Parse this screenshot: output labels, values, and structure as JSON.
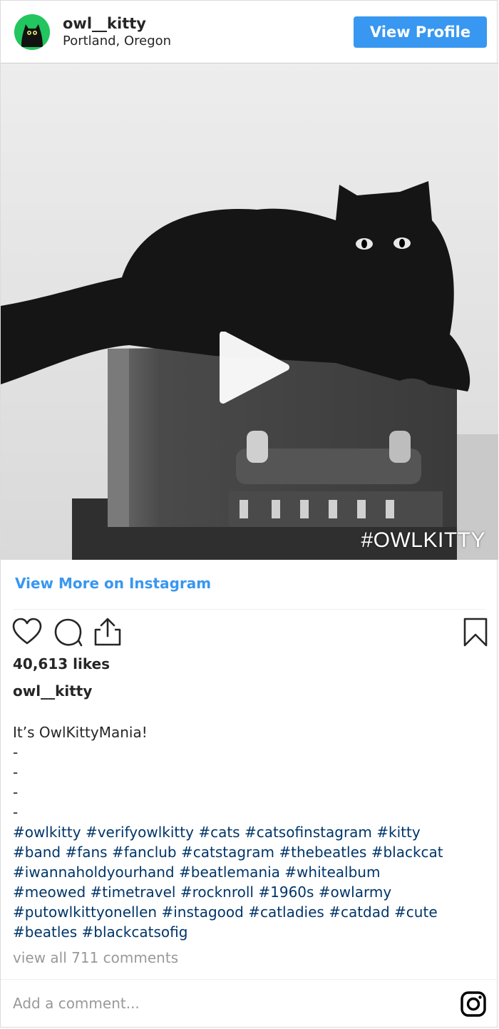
{
  "header": {
    "username": "owl__kitty",
    "location": "Portland, Oregon",
    "view_profile_label": "View Profile"
  },
  "media": {
    "watermark": "#OWLKITTY",
    "play_icon": "play-icon"
  },
  "view_more_label": "View More on Instagram",
  "actions": {
    "icons": [
      "heart-icon",
      "comment-icon",
      "share-icon",
      "bookmark-icon"
    ]
  },
  "likes_text": "40,613 likes",
  "caption": {
    "username": "owl__kitty",
    "lines": [
      "It’s OwlKittyMania!",
      "-",
      "-",
      "-",
      "-"
    ],
    "hashtags": [
      "#owlkitty",
      "#verifyowlkitty",
      "#cats",
      "#catsofinstagram",
      "#kitty",
      "#band",
      "#fans",
      "#fanclub",
      "#catstagram",
      "#thebeatles",
      "#blackcat",
      "#iwannaholdyourhand",
      "#beatlemania",
      "#whitealbum",
      "#meowed",
      "#timetravel",
      "#rocknroll",
      "#1960s",
      "#owlarmy",
      "#putowlkittyonellen",
      "#instagood",
      "#catladies",
      "#catdad",
      "#cute",
      "#beatles",
      "#blackcatsofig"
    ]
  },
  "comments_link": "view all 711 comments",
  "comment_input": {
    "placeholder": "Add a comment..."
  },
  "colors": {
    "accent": "#3897f0",
    "hashtag": "#003569",
    "muted": "#999999",
    "avatar_bg": "#22c55e"
  }
}
